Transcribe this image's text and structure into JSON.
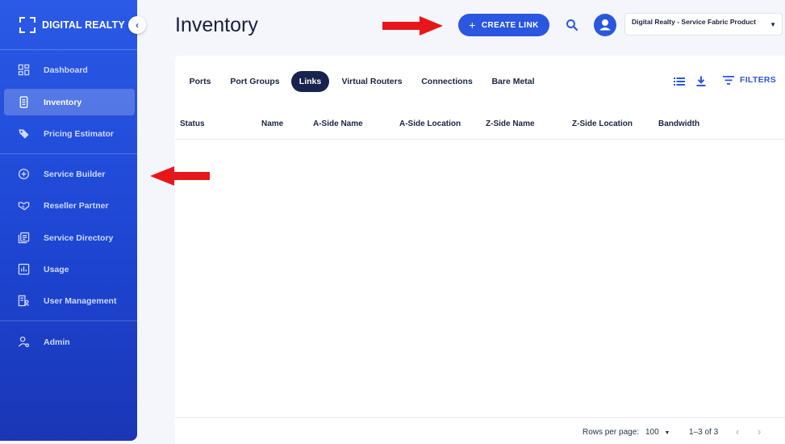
{
  "sidebar": {
    "logo_text": "DIGITAL REALTY",
    "items": [
      {
        "label": "Dashboard",
        "icon": "dashboard-icon"
      },
      {
        "label": "Inventory",
        "icon": "inventory-icon"
      },
      {
        "label": "Pricing Estimator",
        "icon": "tag-icon"
      },
      {
        "label": "Service Builder",
        "icon": "plus-circle-icon"
      },
      {
        "label": "Reseller Partner",
        "icon": "handshake-icon"
      },
      {
        "label": "Service Directory",
        "icon": "directory-icon"
      },
      {
        "label": "Usage",
        "icon": "chart-icon"
      },
      {
        "label": "User Management",
        "icon": "user-management-icon"
      },
      {
        "label": "Admin",
        "icon": "admin-icon"
      }
    ]
  },
  "header": {
    "title": "Inventory",
    "create_label": "CREATE LINK",
    "org_name": "Digital Realty - Service Fabric Product"
  },
  "tabs": [
    "Ports",
    "Port Groups",
    "Links",
    "Virtual Routers",
    "Connections",
    "Bare Metal"
  ],
  "active_tab": "Links",
  "toolbar": {
    "filters_label": "FILTERS"
  },
  "table": {
    "columns": [
      "Status",
      "Name",
      "A-Side Name",
      "A-Side Location",
      "Z-Side Name",
      "Z-Side Location",
      "Bandwidth"
    ]
  },
  "footer": {
    "rows_per_page_label": "Rows per page:",
    "rows_per_page_value": "100",
    "range": "1–3 of 3"
  },
  "colors": {
    "accent": "#2a56e0",
    "sidebar": "#1d46d3",
    "active_tab": "#18244d",
    "annotation_arrow": "#e8161b"
  }
}
